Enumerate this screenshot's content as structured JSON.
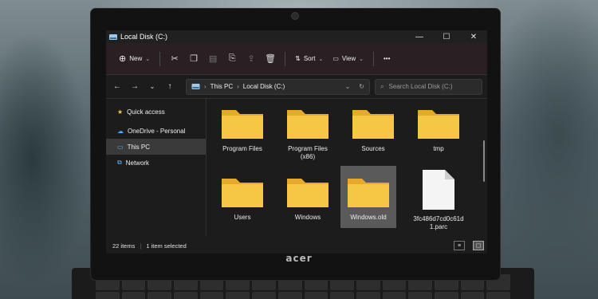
{
  "window": {
    "title": "Local Disk (C:)"
  },
  "window_controls": {
    "minimize": "—",
    "maximize": "☐",
    "close": "✕"
  },
  "commandbar": {
    "new_label": "New",
    "sort_label": "Sort",
    "view_label": "View",
    "more_label": "•••"
  },
  "address": {
    "crumbs": [
      "This PC",
      "Local Disk (C:)"
    ],
    "search_placeholder": "Search Local Disk (C:)"
  },
  "sidebar": {
    "items": [
      {
        "label": "Quick access",
        "icon": "star-icon"
      },
      {
        "label": "OneDrive - Personal",
        "icon": "cloud-icon"
      },
      {
        "label": "This PC",
        "icon": "monitor-icon",
        "active": true
      },
      {
        "label": "Network",
        "icon": "network-icon"
      }
    ]
  },
  "files": [
    {
      "name": "Program Files",
      "type": "folder"
    },
    {
      "name": "Program Files (x86)",
      "type": "folder"
    },
    {
      "name": "Sources",
      "type": "folder"
    },
    {
      "name": "tmp",
      "type": "folder"
    },
    {
      "name": "Users",
      "type": "folder"
    },
    {
      "name": "Windows",
      "type": "folder"
    },
    {
      "name": "Windows.old",
      "type": "folder",
      "selected": true
    },
    {
      "name": "3fc486d7cd0c61d1.parc",
      "type": "file"
    }
  ],
  "status": {
    "items": "22 items",
    "selected": "1 item selected"
  },
  "laptop": {
    "brand": "acer"
  },
  "colors": {
    "folder": "#f6c744",
    "folder_dark": "#e7a92a",
    "accent_bar": "#2a1f22"
  }
}
